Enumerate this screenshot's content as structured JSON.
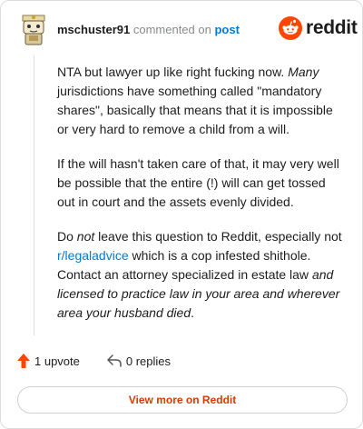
{
  "header": {
    "username": "mschuster91",
    "action_text": "commented on",
    "post_link": "post",
    "brand": "reddit"
  },
  "comment": {
    "p1_a": "NTA but lawyer up like right fucking now. ",
    "p1_em": "Many",
    "p1_b": " jurisdictions have something called \"mandatory shares\", basically that means that it is impossible or very hard to remove a child from a will.",
    "p2": "If the will hasn't taken care of that, it may very well be possible that the entire (!) will can get tossed out in court and the assets evenly divided.",
    "p3_a": "Do ",
    "p3_em1": "not",
    "p3_b": " leave this question to Reddit, especially not ",
    "p3_link": "r/legaladvice",
    "p3_c": " which is a cop infested shithole. Contact an attorney specialized in estate law ",
    "p3_em2": "and licensed to practice law in your area and wherever area your husband died",
    "p3_d": "."
  },
  "actions": {
    "upvotes": "1 upvote",
    "replies": "0 replies"
  },
  "footer": {
    "view_more": "View more on Reddit"
  },
  "colors": {
    "accent_orange": "#ff4500",
    "link_blue": "#0079d3",
    "button_text": "#d93a00"
  },
  "icons": {
    "avatar": "snoo-avatar-icon",
    "logo": "reddit-snoo-icon",
    "upvote": "upvote-arrow-icon",
    "reply": "reply-arrow-icon"
  }
}
